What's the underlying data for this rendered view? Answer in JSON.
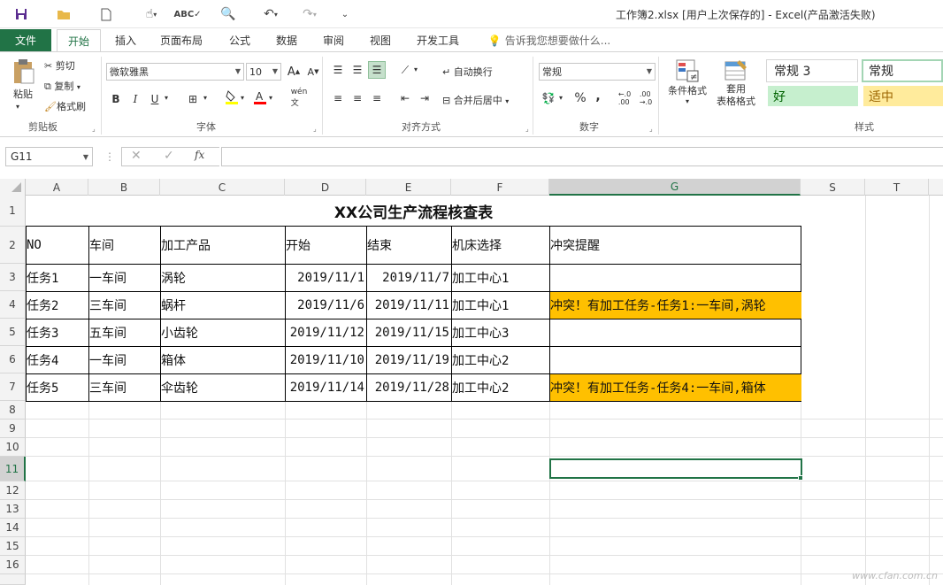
{
  "window": {
    "title": "工作簿2.xlsx [用户上次保存的] - Excel(产品激活失败)"
  },
  "ribbon_tabs": [
    "文件",
    "开始",
    "插入",
    "页面布局",
    "公式",
    "数据",
    "审阅",
    "视图",
    "开发工具"
  ],
  "tell_me": "告诉我您想要做什么...",
  "clipboard": {
    "paste": "粘贴",
    "cut": "剪切",
    "copy": "复制",
    "format_painter": "格式刷",
    "label": "剪贴板"
  },
  "font": {
    "name": "微软雅黑",
    "size": "10",
    "label": "字体",
    "bold": "B",
    "italic": "I",
    "underline": "U",
    "grow": "A",
    "shrink": "A"
  },
  "alignment": {
    "wrap": "自动换行",
    "merge": "合并后居中",
    "label": "对齐方式"
  },
  "number": {
    "format": "常规",
    "label": "数字",
    "percent": "%",
    "comma": ","
  },
  "styles": {
    "cond_format": "条件格式",
    "table_format": "套用\n表格格式",
    "label": "样式",
    "normal3": "常规 3",
    "normal": "常规",
    "good": "好",
    "neutral": "适中",
    "good_color": "#c6efce",
    "neutral_color": "#ffeb9c"
  },
  "name_box": "G11",
  "fx": "fx",
  "columns": [
    "A",
    "B",
    "C",
    "D",
    "E",
    "F",
    "G",
    "S",
    "T"
  ],
  "rows": [
    "1",
    "2",
    "3",
    "4",
    "5",
    "6",
    "7",
    "8",
    "9",
    "10",
    "11",
    "12",
    "13",
    "14",
    "15",
    "16"
  ],
  "sheet": {
    "title": "XX公司生产流程核查表",
    "headers": [
      "NO",
      "车间",
      "加工产品",
      "开始",
      "结束",
      "机床选择",
      "冲突提醒"
    ],
    "data": [
      [
        "任务1",
        "一车间",
        "涡轮",
        "2019/11/1",
        "2019/11/7",
        "加工中心1",
        ""
      ],
      [
        "任务2",
        "三车间",
        "蜗杆",
        "2019/11/6",
        "2019/11/11",
        "加工中心1",
        "冲突！有加工任务-任务1:一车间,涡轮"
      ],
      [
        "任务3",
        "五车间",
        "小齿轮",
        "2019/11/12",
        "2019/11/15",
        "加工中心3",
        ""
      ],
      [
        "任务4",
        "一车间",
        "箱体",
        "2019/11/10",
        "2019/11/19",
        "加工中心2",
        ""
      ],
      [
        "任务5",
        "三车间",
        "伞齿轮",
        "2019/11/14",
        "2019/11/28",
        "加工中心2",
        "冲突！有加工任务-任务4:一车间,箱体"
      ]
    ]
  },
  "highlight_color": "#ffc000",
  "accent_color": "#217346",
  "watermark": "www.cfan.com.cn"
}
